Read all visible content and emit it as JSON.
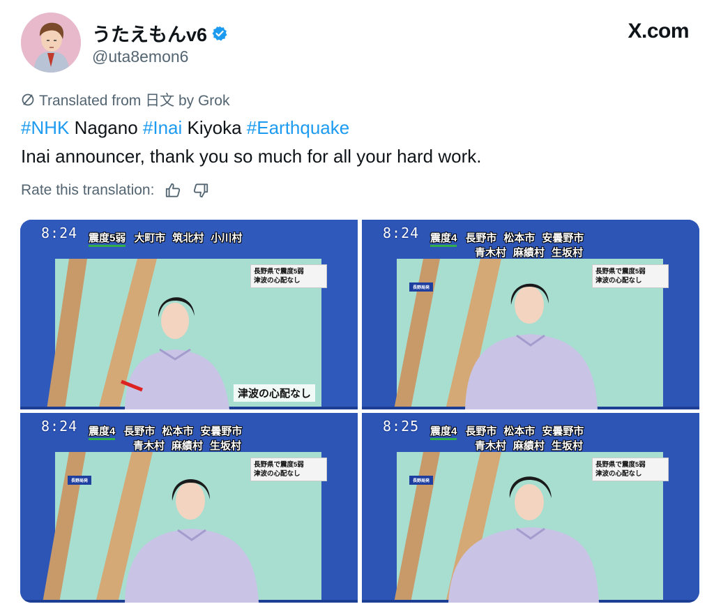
{
  "header": {
    "display_name": "うたえもんv6",
    "handle": "@uta8emon6",
    "site": "X.com"
  },
  "translation": {
    "label": "Translated from 日文 by Grok",
    "rate_label": "Rate this translation:"
  },
  "tweet": {
    "hashtag1": "#NHK",
    "word1": " Nagano ",
    "hashtag2": "#Inai",
    "word2": " Kiyoka ",
    "hashtag3": "#Earthquake",
    "line2": "Inai announcer, thank you so much for all your hard work."
  },
  "icons": {
    "thumbs_up": "thumbs-up-icon",
    "thumbs_down": "thumbs-down-icon",
    "verified": "verified-badge-icon",
    "translate": "translate-icon"
  },
  "colors": {
    "hashtag": "#1d9bf0",
    "verified": "#1d9bf0",
    "broadcast_blue": "#2e58b8",
    "intensity_underline": "#2fae4a"
  },
  "frames": [
    {
      "time": "8:24",
      "intensity": "震度5弱",
      "places1": [
        "大町市",
        "筑北村",
        "小川村"
      ],
      "places2": [],
      "box_line1": "長野県で震度5弱",
      "box_line2": "津波の心配なし",
      "badge": "",
      "subtitle": "津波の心配なし"
    },
    {
      "time": "8:24",
      "intensity": "震度4",
      "places1": [
        "長野市",
        "松本市",
        "安曇野市"
      ],
      "places2": [
        "青木村",
        "麻績村",
        "生坂村"
      ],
      "box_line1": "長野県で震度5弱",
      "box_line2": "津波の心配なし",
      "badge": "長野局発",
      "subtitle": ""
    },
    {
      "time": "8:24",
      "intensity": "震度4",
      "places1": [
        "長野市",
        "松本市",
        "安曇野市"
      ],
      "places2": [
        "青木村",
        "麻績村",
        "生坂村"
      ],
      "box_line1": "長野県で震度5弱",
      "box_line2": "津波の心配なし",
      "badge": "長野局発",
      "subtitle": ""
    },
    {
      "time": "8:25",
      "intensity": "震度4",
      "places1": [
        "長野市",
        "松本市",
        "安曇野市"
      ],
      "places2": [
        "青木村",
        "麻績村",
        "生坂村"
      ],
      "box_line1": "長野県で震度5弱",
      "box_line2": "津波の心配なし",
      "badge": "長野局発",
      "subtitle": ""
    }
  ]
}
